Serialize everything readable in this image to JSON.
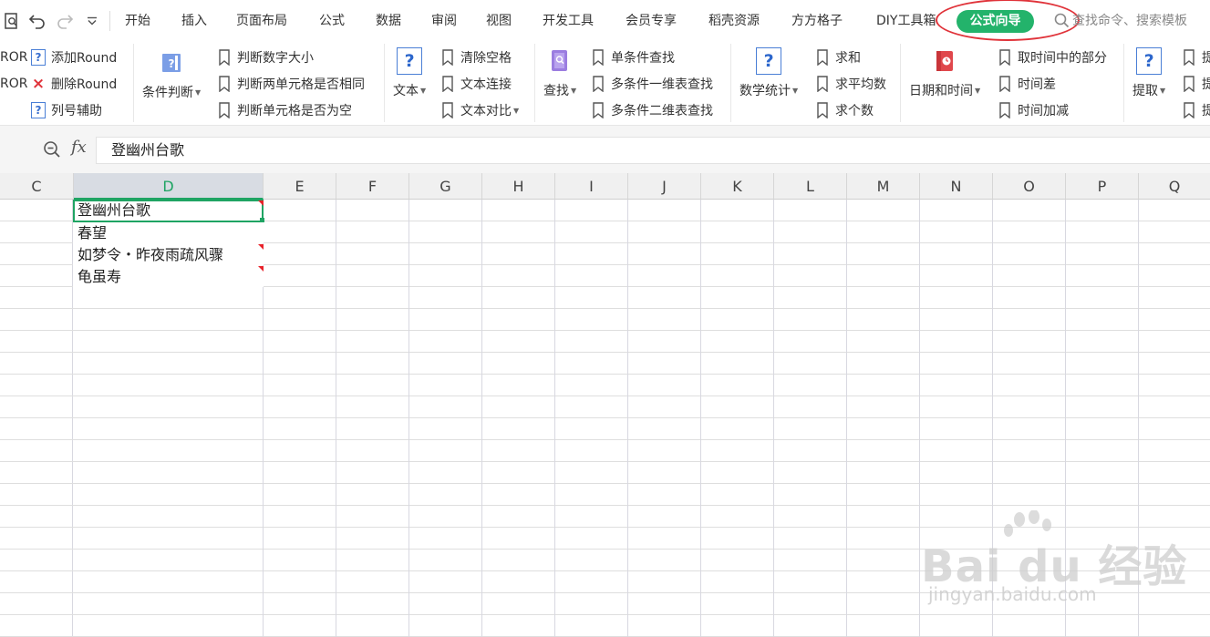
{
  "menubar": {
    "tabs": [
      "开始",
      "插入",
      "页面布局",
      "公式",
      "数据",
      "审阅",
      "视图",
      "开发工具",
      "会员专享",
      "稻壳资源",
      "方方格子",
      "DIY工具箱"
    ],
    "active_tab": "公式向导",
    "search_placeholder": "查找命令、搜索模板",
    "accent_color": "#23b36b",
    "highlight_color": "#e0333a"
  },
  "ribbon": {
    "g1": {
      "items": [
        "ROR",
        "ROR"
      ],
      "buttons": [
        "添加Round",
        "删除Round",
        "列号辅助"
      ]
    },
    "g2": {
      "big": "条件判断",
      "items": [
        "判断数字大小",
        "判断两单元格是否相同",
        "判断单元格是否为空"
      ]
    },
    "g3": {
      "big": "文本",
      "items": [
        "清除空格",
        "文本连接",
        "文本对比"
      ]
    },
    "g4": {
      "big": "查找",
      "items": [
        "单条件查找",
        "多条件一维表查找",
        "多条件二维表查找"
      ]
    },
    "g5": {
      "big": "数学统计",
      "items": [
        "求和",
        "求平均数",
        "求个数"
      ]
    },
    "g6": {
      "big": "日期和时间",
      "items": [
        "取时间中的部分",
        "时间差",
        "时间加减"
      ]
    },
    "g7": {
      "big": "提取",
      "items": [
        "提",
        "提",
        "提"
      ]
    }
  },
  "formula_bar": {
    "fx": "fx",
    "value": "登幽州台歌"
  },
  "grid": {
    "columns": [
      "C",
      "D",
      "E",
      "F",
      "G",
      "H",
      "I",
      "J",
      "K",
      "L",
      "M",
      "N",
      "O",
      "P",
      "Q"
    ],
    "selected_column": "D",
    "cells": [
      "登幽州台歌",
      "春望",
      "如梦令・昨夜雨疏风骤",
      "龟虽寿"
    ]
  },
  "watermark": {
    "text": "Bai du 经验",
    "url": "jingyan.baidu.com"
  }
}
